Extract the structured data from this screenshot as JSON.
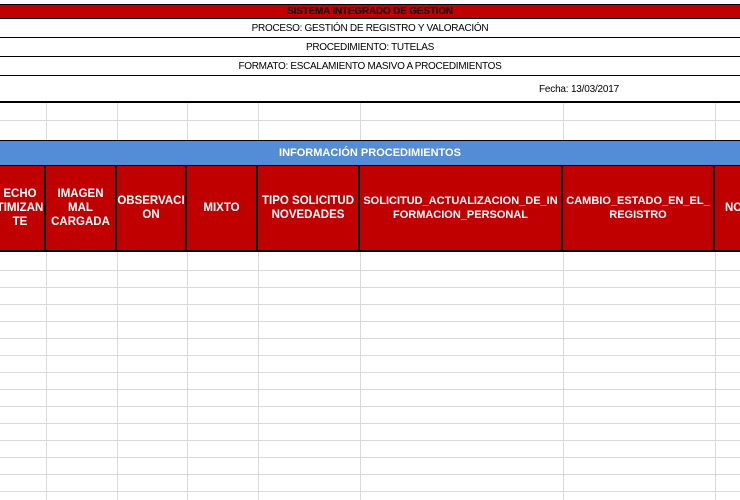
{
  "header": {
    "system": "SISTEMA INTEGRADO DE GESTION",
    "process": "PROCESO:  GESTIÓN DE REGISTRO Y VALORACIÓN",
    "procedure": "PROCEDIMIENTO: TUTELAS",
    "format": "FORMATO: ESCALAMIENTO MASIVO A PROCEDIMIENTOS",
    "date": "Fecha:  13/03/2017"
  },
  "section": {
    "title": "INFORMACIÓN PROCEDIMIENTOS"
  },
  "columns": [
    {
      "label": "ECHO\nTIMIZAN\nTE"
    },
    {
      "label": "IMAGEN\nMAL\nCARGADA"
    },
    {
      "label": "OBSERVACI\nON"
    },
    {
      "label": "MIXTO"
    },
    {
      "label": "TIPO SOLICITUD\nNOVEDADES"
    },
    {
      "label": "SOLICITUD_ACTUALIZACION_DE_IN\nFORMACION_PERSONAL"
    },
    {
      "label": "CAMBIO_ESTADO_EN_EL_\nREGISTRO"
    },
    {
      "label": "NO"
    }
  ],
  "colors": {
    "header_red": "#c00000",
    "section_blue": "#538dd5",
    "gridline": "#d9d9d9"
  }
}
